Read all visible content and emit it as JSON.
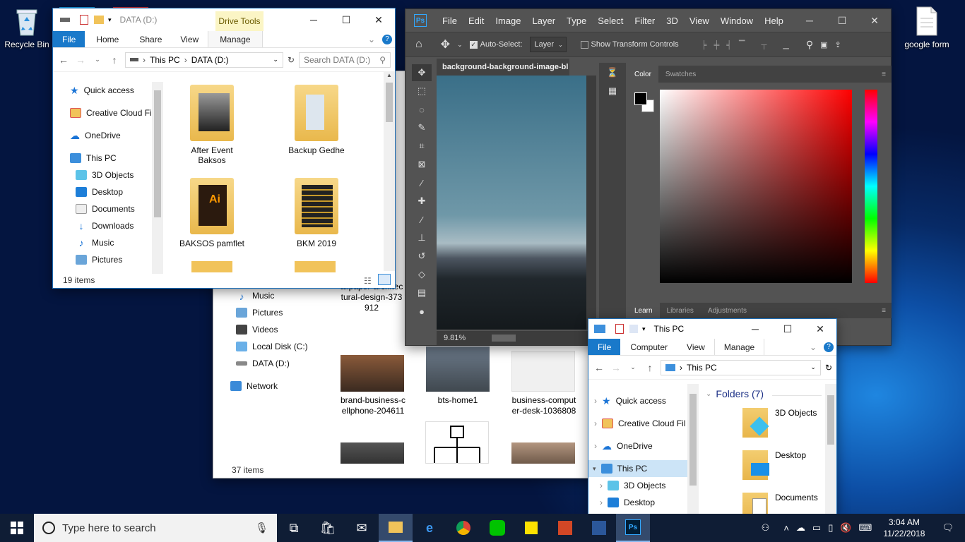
{
  "desktop": {
    "icons": [
      {
        "label": "Recycle Bin"
      },
      {
        "label": "google form"
      }
    ]
  },
  "explorer_main": {
    "title": "DATA (D:)",
    "ribbon_context": "Drive Tools",
    "tabs": [
      "File",
      "Home",
      "Share",
      "View",
      "Manage"
    ],
    "breadcrumb": [
      "This PC",
      "DATA (D:)"
    ],
    "search_placeholder": "Search DATA (D:)",
    "nav": [
      {
        "label": "Quick access",
        "icon": "star-icon"
      },
      {
        "label": "Creative Cloud Fil",
        "icon": "creative-cloud-icon"
      },
      {
        "label": "OneDrive",
        "icon": "onedrive-icon"
      },
      {
        "label": "This PC",
        "icon": "pc-icon"
      },
      {
        "label": "3D Objects",
        "icon": "3d-objects-icon"
      },
      {
        "label": "Desktop",
        "icon": "desktop-icon"
      },
      {
        "label": "Documents",
        "icon": "documents-icon"
      },
      {
        "label": "Downloads",
        "icon": "downloads-icon"
      },
      {
        "label": "Music",
        "icon": "music-icon"
      },
      {
        "label": "Pictures",
        "icon": "pictures-icon"
      }
    ],
    "items": [
      "After Event\nBaksos",
      "Backup Gedhe",
      "BAKSOS pamflet",
      "BKM 2019"
    ],
    "status": "19 items"
  },
  "explorer_back": {
    "nav": [
      {
        "label": "Music"
      },
      {
        "label": "Pictures"
      },
      {
        "label": "Videos"
      },
      {
        "label": "Local Disk (C:)"
      },
      {
        "label": "DATA (D:)"
      },
      {
        "label": "Network"
      }
    ],
    "files": [
      "allpaper-architec\ntural-design-373\n912",
      "brand-business-c\nellphone-204611",
      "bts-home1",
      "business-comput\ner-desk-1036808"
    ],
    "status": "37 items"
  },
  "photoshop": {
    "menu": [
      "File",
      "Edit",
      "Image",
      "Layer",
      "Type",
      "Select",
      "Filter",
      "3D",
      "View",
      "Window",
      "Help"
    ],
    "options": {
      "auto_select": "Auto-Select:",
      "layer": "Layer",
      "transform": "Show Transform Controls"
    },
    "doc_tab": "background-background-image-bl",
    "zoom": "9.81%",
    "panel_tabs": [
      "Color",
      "Swatches"
    ],
    "bottom_tabs": [
      "Learn",
      "Libraries",
      "Adjustments"
    ]
  },
  "explorer_pc": {
    "title": "This PC",
    "tabs": [
      "File",
      "Computer",
      "View",
      "Manage"
    ],
    "breadcrumb": "This PC",
    "nav": [
      {
        "label": "Quick access"
      },
      {
        "label": "Creative Cloud Fil"
      },
      {
        "label": "OneDrive"
      },
      {
        "label": "This PC"
      },
      {
        "label": "3D Objects"
      },
      {
        "label": "Desktop"
      }
    ],
    "group": "Folders (7)",
    "folders": [
      "3D Objects",
      "Desktop",
      "Documents"
    ]
  },
  "taskbar": {
    "search": "Type here to search",
    "time": "3:04 AM",
    "date": "11/22/2018"
  }
}
